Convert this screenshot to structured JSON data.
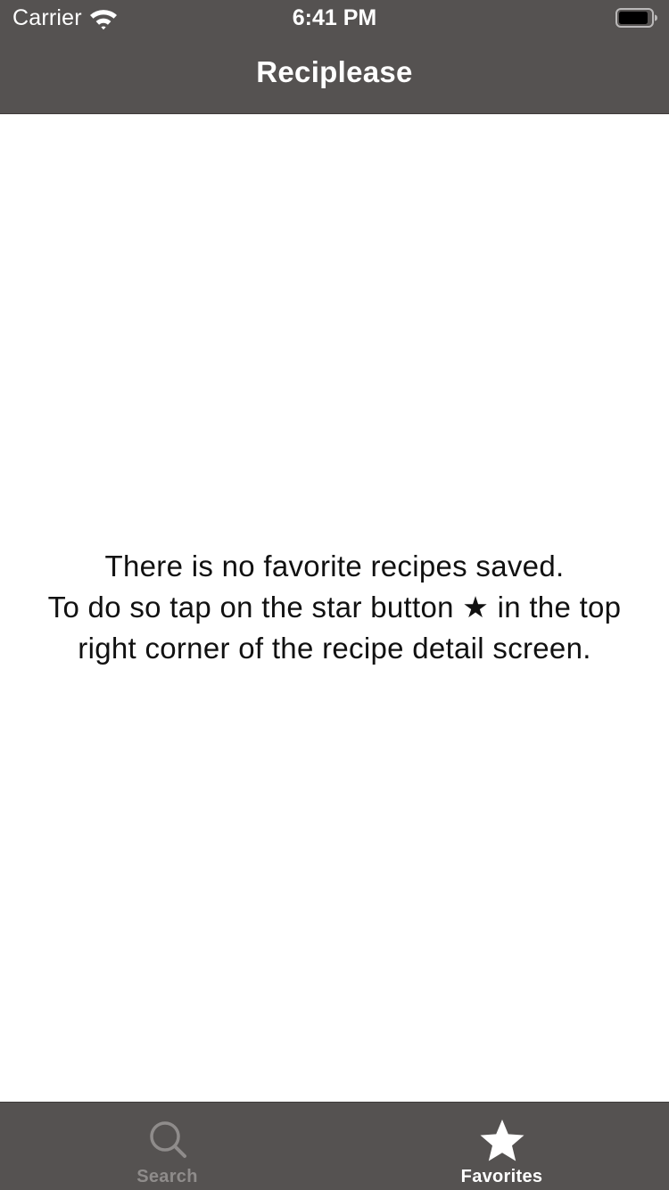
{
  "status_bar": {
    "carrier": "Carrier",
    "time": "6:41 PM",
    "wifi_icon": "wifi-icon",
    "battery_icon": "battery-icon"
  },
  "nav": {
    "title": "Reciplease"
  },
  "empty_state": {
    "lines": [
      "There is no favorite recipes saved.",
      "To do so tap on the star button ★ in the top",
      "right corner of the recipe detail screen."
    ]
  },
  "tabbar": {
    "tabs": [
      {
        "label": "Search",
        "icon": "search-icon",
        "selected": false
      },
      {
        "label": "Favorites",
        "icon": "star-icon",
        "selected": true
      }
    ]
  },
  "colors": {
    "bar_background": "#555251",
    "tab_inactive": "#8f8c8b",
    "tab_active": "#ffffff",
    "content_background": "#ffffff",
    "text": "#111111"
  }
}
